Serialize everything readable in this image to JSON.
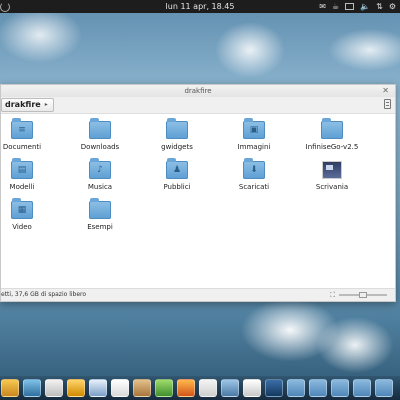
{
  "top_panel": {
    "clock": "lun 11 apr, 18.45"
  },
  "window": {
    "title": "drakfire",
    "breadcrumb": "drakfire",
    "status_text": "etti, 37,6 GB di spazio libero"
  },
  "files": [
    {
      "label": "Documenti",
      "icon": "folder-documents-icon"
    },
    {
      "label": "Downloads",
      "icon": "folder-downloads-icon"
    },
    {
      "label": "gwidgets",
      "icon": "folder-icon"
    },
    {
      "label": "Immagini",
      "icon": "folder-pictures-icon"
    },
    {
      "label": "InfiniseGo-v2.5",
      "icon": "folder-icon"
    },
    {
      "label": "Modelli",
      "icon": "folder-templates-icon"
    },
    {
      "label": "Musica",
      "icon": "folder-music-icon"
    },
    {
      "label": "Pubblici",
      "icon": "folder-publicshare-icon"
    },
    {
      "label": "Scaricati",
      "icon": "folder-download-icon"
    },
    {
      "label": "Scrivania",
      "icon": "desktop-icon"
    },
    {
      "label": "Video",
      "icon": "folder-videos-icon"
    },
    {
      "label": "Esempi",
      "icon": "folder-icon"
    }
  ],
  "colors": {
    "panel": "#1d1d1d",
    "folder": "#5d9ed3"
  }
}
